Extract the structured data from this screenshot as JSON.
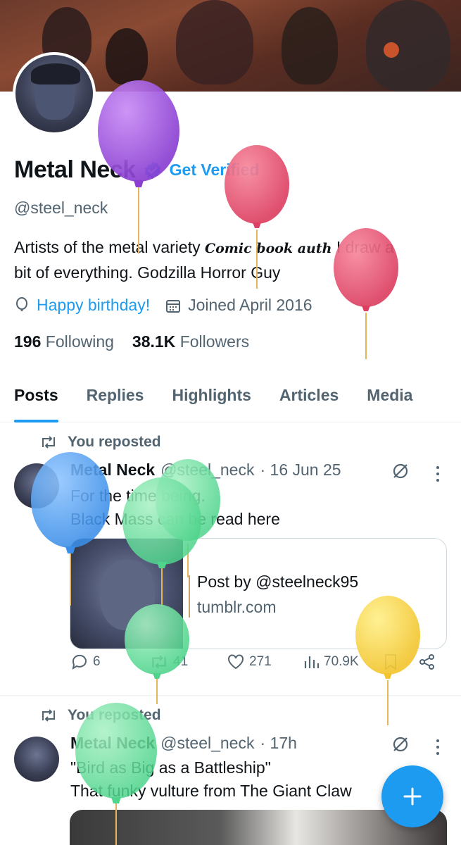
{
  "profile": {
    "name": "Metal Neck",
    "get_verified": "Get Verified",
    "handle": "@steel_neck",
    "bio_line1_a": "Artists of the metal variety",
    "bio_script": "Comic book auth",
    "bio_line1_b": "I draw a",
    "bio_line2": "bit of everything. Godzilla Horror Guy",
    "birthday": "Happy birthday!",
    "joined": "Joined April 2016",
    "following_count": "196",
    "following_label": "Following",
    "followers_count": "38.1K",
    "followers_label": "Followers"
  },
  "tabs": [
    "Posts",
    "Replies",
    "Highlights",
    "Articles",
    "Media"
  ],
  "posts": [
    {
      "repost_label": "You reposted",
      "name": "Metal Neck",
      "handle": "@steel_neck",
      "time": "· 16 Jun 25",
      "body_line1": "For the time being.",
      "body_line2": "Black Mass can be read here",
      "card_title": "Post by @steelneck95",
      "card_domain": "tumblr.com",
      "replies": "6",
      "reposts": "41",
      "likes": "271",
      "views": "70.9K"
    },
    {
      "repost_label": "You reposted",
      "name": "Metal Neck",
      "handle": "@steel_neck",
      "time": "· 17h",
      "body_line1": "\"Bird as Big as a Battleship\"",
      "body_line2": "That funky vulture from The Giant Claw"
    }
  ],
  "colors": {
    "accent": "#1d9bf0",
    "text": "#0f1419",
    "muted": "#536471"
  }
}
